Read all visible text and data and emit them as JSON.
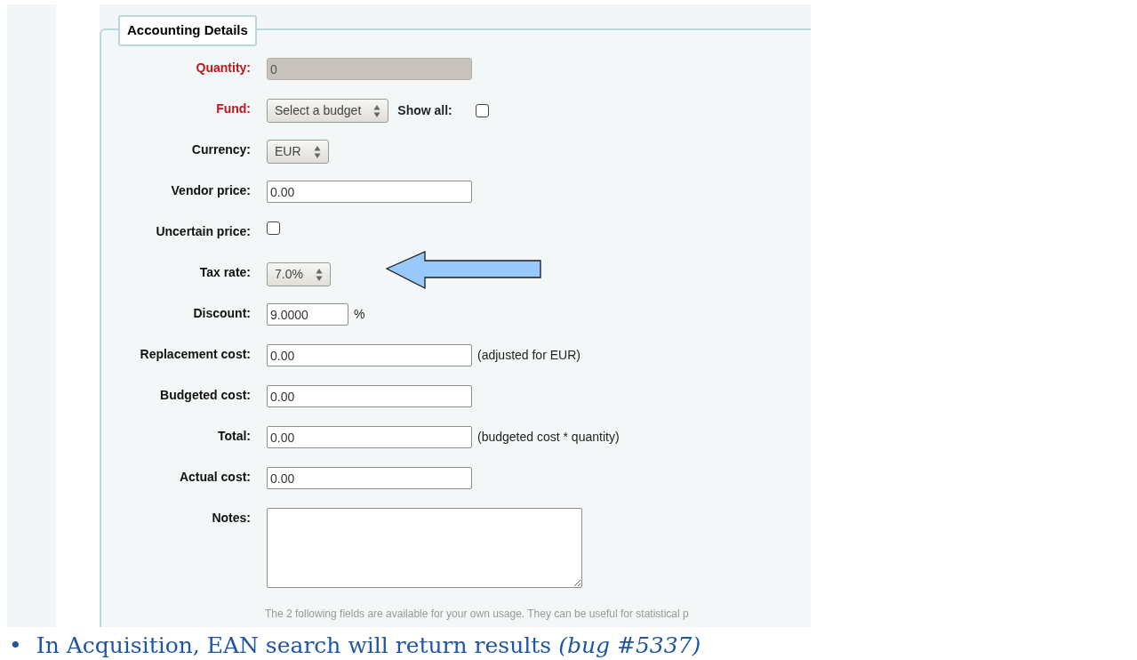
{
  "legend": "Accounting Details",
  "fields": [
    {
      "kind": "text",
      "label": "Quantity:",
      "required": true,
      "disabled": true,
      "value": "0"
    },
    {
      "kind": "select",
      "label": "Fund:",
      "required": true,
      "value": "Select a budget",
      "extra_label": "Show all:",
      "extra_checked": false
    },
    {
      "kind": "select",
      "label": "Currency:",
      "required": false,
      "value": "EUR"
    },
    {
      "kind": "text",
      "label": "Vendor price:",
      "required": false,
      "disabled": false,
      "value": "0.00"
    },
    {
      "kind": "checkbox",
      "label": "Uncertain price:",
      "required": false,
      "checked": false
    },
    {
      "kind": "select",
      "label": "Tax rate:",
      "required": false,
      "value": "7.0%"
    },
    {
      "kind": "short",
      "label": "Discount:",
      "required": false,
      "disabled": false,
      "value": "9.0000",
      "suffix": "%"
    },
    {
      "kind": "text",
      "label": "Replacement cost:",
      "required": false,
      "disabled": false,
      "value": "0.00",
      "suffix": "(adjusted for EUR)"
    },
    {
      "kind": "text",
      "label": "Budgeted cost:",
      "required": false,
      "disabled": false,
      "value": "0.00"
    },
    {
      "kind": "text",
      "label": "Total:",
      "required": false,
      "disabled": false,
      "value": "0.00",
      "suffix": "(budgeted cost * quantity)"
    },
    {
      "kind": "text",
      "label": "Actual cost:",
      "required": false,
      "disabled": false,
      "value": "0.00"
    },
    {
      "kind": "textarea",
      "label": "Notes:",
      "required": false
    }
  ],
  "footnote": "The 2 following fields are available for your own usage. They can be useful for statistical p",
  "bullet": {
    "marker": "•",
    "text": "In Acquisition, EAN search will return results *(bug #5337)*"
  }
}
